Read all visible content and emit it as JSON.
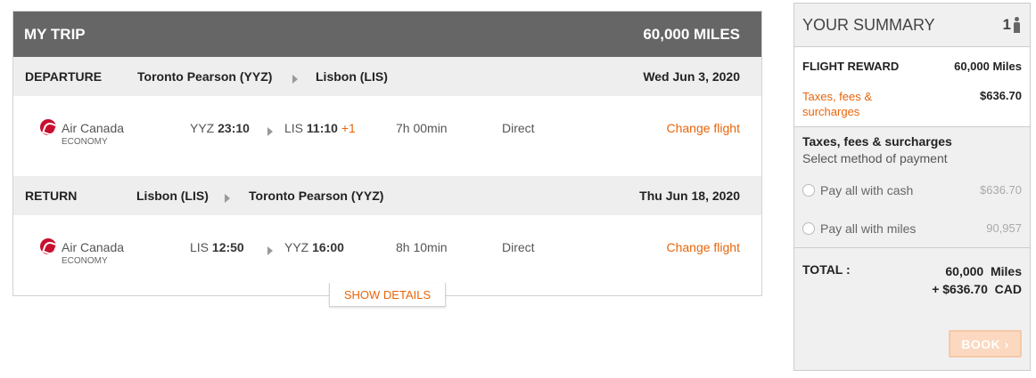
{
  "trip": {
    "title": "MY TRIP",
    "miles": "60,000 MILES",
    "show_details": "SHOW DETAILS",
    "segments": [
      {
        "label": "DEPARTURE",
        "from": "Toronto Pearson (YYZ)",
        "to": "Lisbon (LIS)",
        "date": "Wed Jun 3, 2020",
        "airline": "Air Canada",
        "cabin": "ECONOMY",
        "dep_code": "YYZ",
        "dep_time": "23:10",
        "arr_code": "LIS",
        "arr_time": "11:10",
        "day_offset": "+1",
        "duration": "7h 00min",
        "stops": "Direct",
        "change": "Change flight"
      },
      {
        "label": "RETURN",
        "from": "Lisbon (LIS)",
        "to": "Toronto Pearson (YYZ)",
        "date": "Thu Jun 18, 2020",
        "airline": "Air Canada",
        "cabin": "ECONOMY",
        "dep_code": "LIS",
        "dep_time": "12:50",
        "arr_code": "YYZ",
        "arr_time": "16:00",
        "day_offset": "",
        "duration": "8h 10min",
        "stops": "Direct",
        "change": "Change flight"
      }
    ]
  },
  "summary": {
    "title": "YOUR SUMMARY",
    "passengers": "1",
    "passenger_icon": "person-icon",
    "flight_reward_label": "FLIGHT REWARD",
    "flight_reward_value": "60,000 Miles",
    "taxes_label": "Taxes, fees & surcharges",
    "taxes_value": "$636.70",
    "taxes_section_title": "Taxes, fees & surcharges",
    "taxes_section_sub": "Select method of payment",
    "pay_cash_label": "Pay all with cash",
    "pay_cash_value": "$636.70",
    "pay_miles_label": "Pay all with miles",
    "pay_miles_value": "90,957",
    "total_label": "TOTAL :",
    "total_miles": "60,000  Miles",
    "total_cash": "+ $636.70  CAD",
    "book_label": "BOOK"
  },
  "colors": {
    "accent": "#e8650a",
    "header_bg": "#666666",
    "segment_bg": "#eeeeee",
    "airline_logo": "#c8102e"
  }
}
